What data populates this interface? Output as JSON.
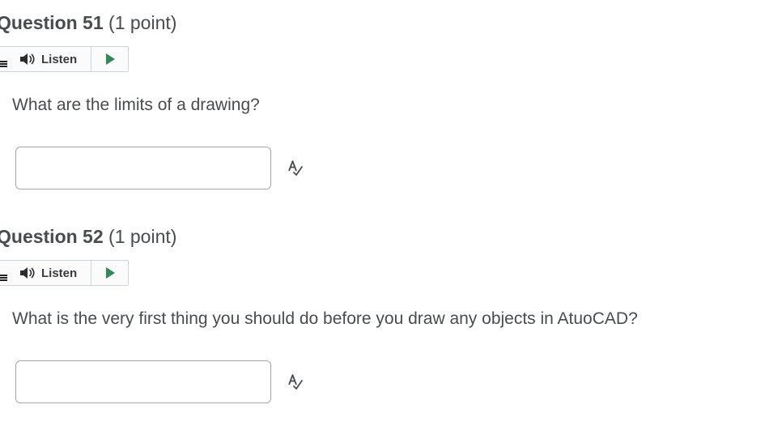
{
  "questions": [
    {
      "title": "Question 51",
      "points": "(1 point)",
      "listen_label": "Listen",
      "text": "What are the limits of a drawing?",
      "answer": {
        "value": "",
        "placeholder": ""
      },
      "spell_check_icon": "spell-check-icon"
    },
    {
      "title": "Question 52",
      "points": "(1 point)",
      "listen_label": "Listen",
      "text": "What is the very first thing you should do before you draw any objects in AtuoCAD?",
      "answer": {
        "value": "",
        "placeholder": ""
      },
      "spell_check_icon": "spell-check-icon"
    }
  ],
  "colors": {
    "text": "#494c4e",
    "play": "#2e8b57",
    "border": "#cdd5dc",
    "input_border": "#a3a7ab"
  }
}
